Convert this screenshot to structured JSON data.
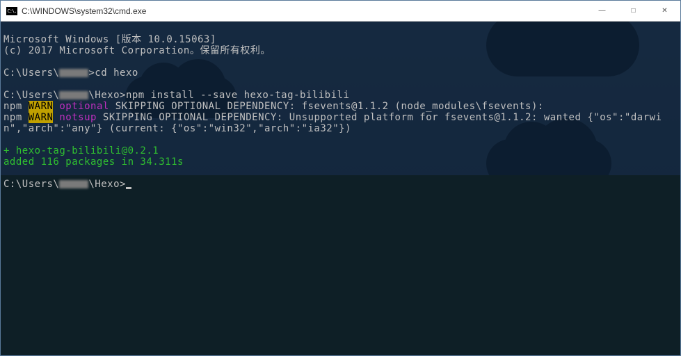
{
  "titlebar": {
    "icon_text": "C:\\.",
    "title": "C:\\WINDOWS\\system32\\cmd.exe",
    "minimize": "—",
    "maximize": "□",
    "close": "✕"
  },
  "term": {
    "header1": "Microsoft Windows [版本 10.0.15063]",
    "header2": "(c) 2017 Microsoft Corporation。保留所有权利。",
    "prompt1_pre": "C:\\Users\\",
    "prompt1_post": ">",
    "cmd1": "cd hexo",
    "prompt2_pre": "C:\\Users\\",
    "prompt2_mid": "\\Hexo>",
    "cmd2": "npm install --save hexo-tag-bilibili",
    "warn_label": "WARN",
    "npm": "npm",
    "w1_tag": " optional",
    "w1_msg": " SKIPPING OPTIONAL DEPENDENCY: fsevents@1.1.2 (node_modules\\fsevents):",
    "w2_tag": " notsup",
    "w2_msg": " SKIPPING OPTIONAL DEPENDENCY: Unsupported platform for fsevents@1.1.2: wanted {\"os\":\"darwin\",\"arch\":\"any\"} (current: {\"os\":\"win32\",\"arch\":\"ia32\"})",
    "result1": "+ hexo-tag-bilibili@0.2.1",
    "result2": "added 116 packages in 34.311s",
    "prompt3_pre": "C:\\Users\\",
    "prompt3_mid": "\\Hexo>"
  }
}
